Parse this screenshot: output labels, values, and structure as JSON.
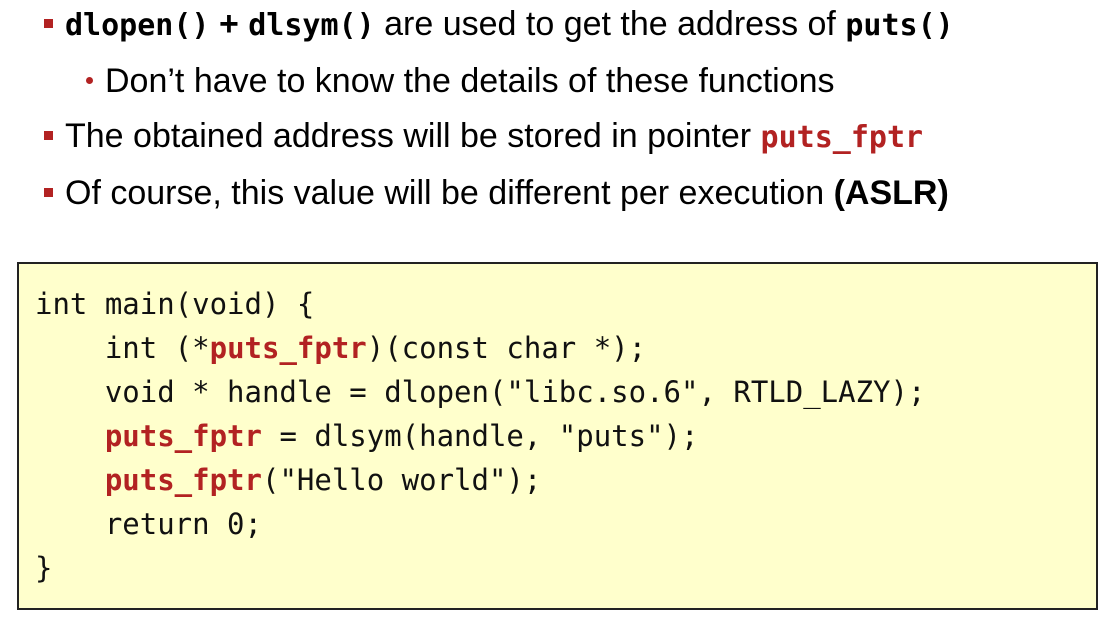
{
  "bullets": {
    "b1": {
      "t1": "dlopen()",
      "t2": " + ",
      "t3": "dlsym()",
      "t4": " are used to get the address of ",
      "t5": "puts()"
    },
    "b2": {
      "t1": "Don’t have to know the details of these functions"
    },
    "b3": {
      "t1": "The obtained address will be stored in pointer ",
      "t2": "puts_fptr"
    },
    "b4": {
      "t1": "Of course, this value will be different per execution ",
      "t2": "(ASLR)"
    }
  },
  "code": {
    "l1": "int main(void) {",
    "l2_pre": "    int (*",
    "l2_hl": "puts_fptr",
    "l2_post": ")(const char *);",
    "l3": "    void * handle = dlopen(\"libc.so.6\", RTLD_LAZY);",
    "l4_pre": "    ",
    "l4_hl": "puts_fptr",
    "l4_post": " = dlsym(handle, \"puts\");",
    "l5_pre": "    ",
    "l5_hl": "puts_fptr",
    "l5_post": "(\"Hello world\");",
    "l6": "    return 0;",
    "l7": "}"
  },
  "colors": {
    "accent": "#b22222",
    "code_background": "#ffffcc"
  }
}
